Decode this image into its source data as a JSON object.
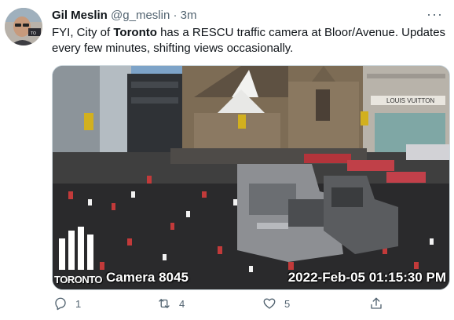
{
  "user": {
    "display_name": "Gil Meslin",
    "handle": "@g_meslin",
    "separator": "·",
    "time": "3m"
  },
  "more_label": "···",
  "tweet": {
    "text_before": "FYI, City of ",
    "text_bold": "Toronto",
    "text_after": " has a RESCU traffic camera at Bloor/Avenue. Updates every few minutes, shifting views occasionally."
  },
  "media": {
    "logo_text": "TORONTO",
    "camera_label": "Camera 8045",
    "timestamp": "2022-Feb-05 01:15:30 PM",
    "scene_store_sign": "LOUIS VUITTON"
  },
  "actions": {
    "reply_count": "1",
    "retweet_count": "4",
    "like_count": "5"
  },
  "icons": {
    "reply": "reply-icon",
    "retweet": "retweet-icon",
    "like": "heart-icon",
    "share": "share-icon"
  }
}
